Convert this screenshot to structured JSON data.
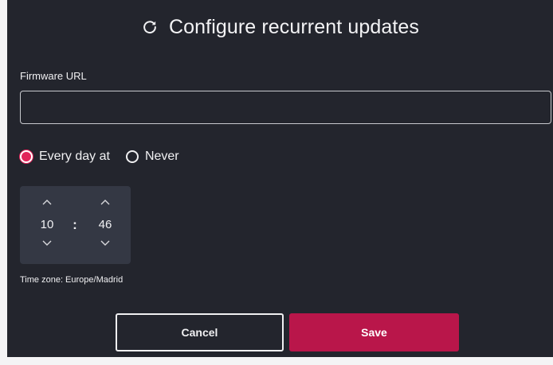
{
  "dialog": {
    "title": "Configure recurrent updates",
    "title_icon": "refresh-icon"
  },
  "firmware": {
    "label": "Firmware URL",
    "value": "",
    "placeholder": ""
  },
  "schedule": {
    "options": [
      {
        "label": "Every day at",
        "checked": true
      },
      {
        "label": "Never",
        "checked": false
      }
    ]
  },
  "time": {
    "hour": "10",
    "minute": "46",
    "separator": ":"
  },
  "timezone": "Time zone: Europe/Madrid",
  "buttons": {
    "cancel": "Cancel",
    "save": "Save"
  },
  "colors": {
    "background": "#23252d",
    "accent": "#e1245a",
    "save_button": "#b9164a",
    "time_picker_bg": "#343844"
  }
}
